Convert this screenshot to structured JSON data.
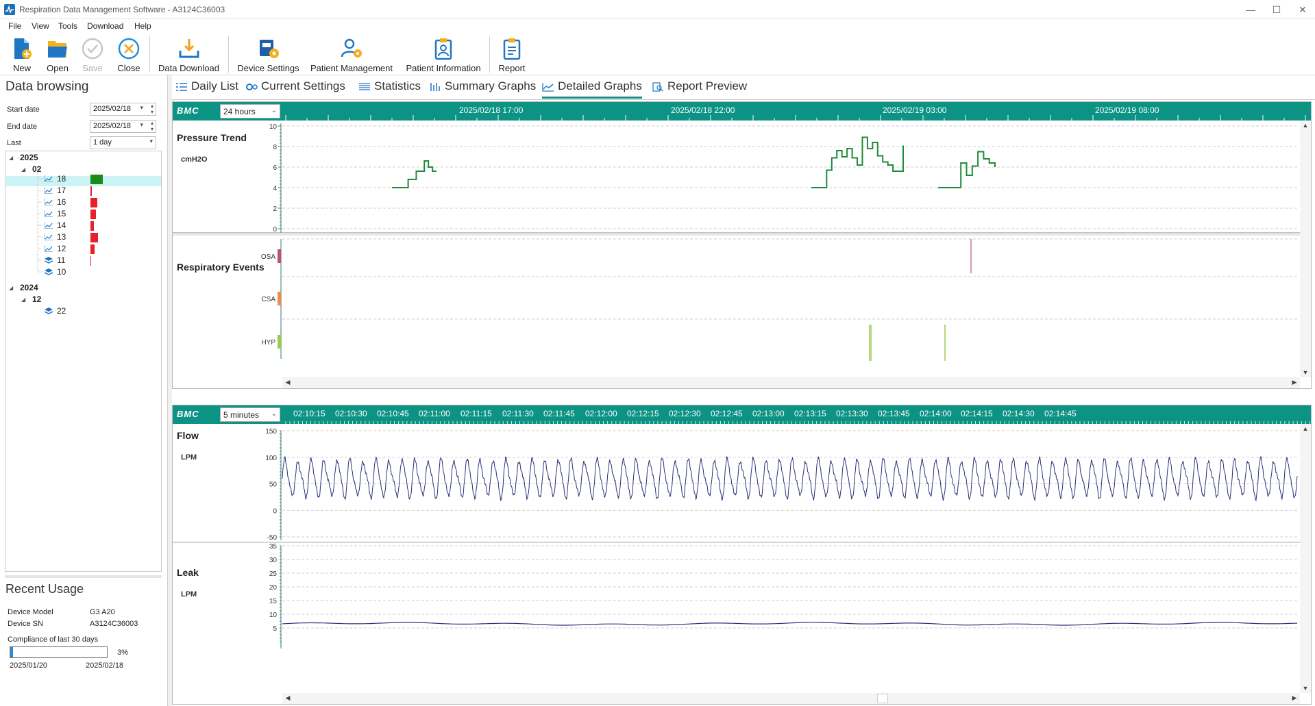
{
  "window": {
    "title": "Respiration Data Management Software - A3124C36003",
    "controls": {
      "minimize": "—",
      "maximize": "☐",
      "close": "✕"
    }
  },
  "menu": [
    "File",
    "View",
    "Tools",
    "Download",
    "Help"
  ],
  "toolbar": {
    "new": "New",
    "open": "Open",
    "save": "Save",
    "close": "Close",
    "data_download": "Data Download",
    "device_settings": "Device Settings",
    "patient_management": "Patient Management",
    "patient_information": "Patient Information",
    "report": "Report"
  },
  "left": {
    "title": "Data browsing",
    "start_label": "Start date",
    "start_value": "2025/02/18",
    "end_label": "End date",
    "end_value": "2025/02/18",
    "last_label": "Last",
    "last_value": "1 day",
    "tree": {
      "y2025": "2025",
      "m02": "02",
      "days": [
        {
          "label": "18",
          "usage": 0.9
        },
        {
          "label": "17",
          "usage": 0.1
        },
        {
          "label": "16",
          "usage": 0.5
        },
        {
          "label": "15",
          "usage": 0.4
        },
        {
          "label": "14",
          "usage": 0.25
        },
        {
          "label": "13",
          "usage": 0.55
        },
        {
          "label": "12",
          "usage": 0.3
        },
        {
          "label": "11",
          "usage": 0.03
        },
        {
          "label": "10",
          "usage": 0.0
        }
      ],
      "y2024": "2024",
      "m12": "12",
      "d22": "22"
    },
    "recent_title": "Recent Usage",
    "device_model_label": "Device Model",
    "device_model": "G3 A20",
    "device_sn_label": "Device SN",
    "device_sn": "A3124C36003",
    "compliance_label": "Compliance of last 30 days",
    "compliance_pct": "3%",
    "compliance_value": 0.03,
    "range_start": "2025/01/20",
    "range_end": "2025/02/18"
  },
  "tabs": [
    "Daily List",
    "Current Settings",
    "Statistics",
    "Summary Graphs",
    "Detailed Graphs",
    "Report Preview"
  ],
  "active_tab": "Detailed Graphs",
  "upper": {
    "logo": "BMC",
    "range": "24 hours",
    "times": [
      "2025/02/18 17:00",
      "2025/02/18 22:00",
      "2025/02/19 03:00",
      "2025/02/19 08:00"
    ],
    "pressure_title": "Pressure Trend",
    "pressure_unit": "cmH2O",
    "pressure_yticks": [
      "10",
      "8",
      "6",
      "4",
      "2",
      "0"
    ],
    "events_title": "Respiratory Events",
    "event_labels": [
      "OSA",
      "CSA",
      "HYP"
    ]
  },
  "lower": {
    "logo": "BMC",
    "range": "5 minutes",
    "times": [
      "02:10:15",
      "02:10:30",
      "02:10:45",
      "02:11:00",
      "02:11:15",
      "02:11:30",
      "02:11:45",
      "02:12:00",
      "02:12:15",
      "02:12:30",
      "02:12:45",
      "02:13:00",
      "02:13:15",
      "02:13:30",
      "02:13:45",
      "02:14:00",
      "02:14:15",
      "02:14:30",
      "02:14:45"
    ],
    "flow_title": "Flow",
    "flow_unit": "LPM",
    "flow_yticks": [
      "150",
      "100",
      "50",
      "0",
      "-50"
    ],
    "leak_title": "Leak",
    "leak_unit": "LPM",
    "leak_yticks": [
      "35",
      "30",
      "25",
      "20",
      "15",
      "10",
      "5"
    ]
  },
  "chart_data": [
    {
      "type": "line",
      "title": "Pressure Trend",
      "ylabel": "cmH2O",
      "ylim": [
        0,
        10
      ],
      "x_labels": [
        "2025/02/18 17:00",
        "2025/02/18 22:00",
        "2025/02/19 03:00",
        "2025/02/19 08:00"
      ],
      "series": [
        {
          "values": [
            4.0,
            4.0,
            4.0,
            4.0,
            4.8,
            4.8,
            5.6,
            5.6,
            6.6,
            6.0,
            5.6,
            5.6
          ]
        },
        {
          "values": [
            4.0,
            4.0,
            4.0,
            5.7,
            6.9,
            7.6,
            7.0,
            7.8,
            6.9,
            6.2,
            8.9,
            7.8,
            8.4,
            7.1,
            6.5,
            6.2,
            5.6,
            5.6,
            8.1
          ]
        },
        {
          "values": [
            4.0,
            4.0,
            4.0,
            4.0,
            6.4,
            5.2,
            6.1,
            7.5,
            6.8,
            6.4,
            6.0
          ]
        }
      ],
      "grid": true
    },
    {
      "type": "scatter",
      "title": "Respiratory Events",
      "categories": [
        "OSA",
        "CSA",
        "HYP"
      ],
      "series": [
        {
          "name": "OSA",
          "values": [
            1
          ]
        },
        {
          "name": "HYP",
          "values": [
            2
          ]
        }
      ]
    },
    {
      "type": "line",
      "title": "Flow",
      "ylabel": "LPM",
      "ylim": [
        -50,
        150
      ],
      "x_labels": [
        "02:10:15",
        "02:10:30",
        "02:10:45",
        "02:11:00",
        "02:11:15",
        "02:11:30",
        "02:11:45",
        "02:12:00",
        "02:12:15",
        "02:12:30",
        "02:12:45",
        "02:13:00",
        "02:13:15",
        "02:13:30",
        "02:13:45",
        "02:14:00",
        "02:14:15",
        "02:14:30",
        "02:14:45"
      ],
      "series": [
        {
          "min": 25,
          "max": 95,
          "cycles": 78
        }
      ],
      "grid": true
    },
    {
      "type": "line",
      "title": "Leak",
      "ylabel": "LPM",
      "ylim": [
        0,
        35
      ],
      "series": [
        {
          "mean": 6.5
        }
      ],
      "grid": true
    }
  ]
}
